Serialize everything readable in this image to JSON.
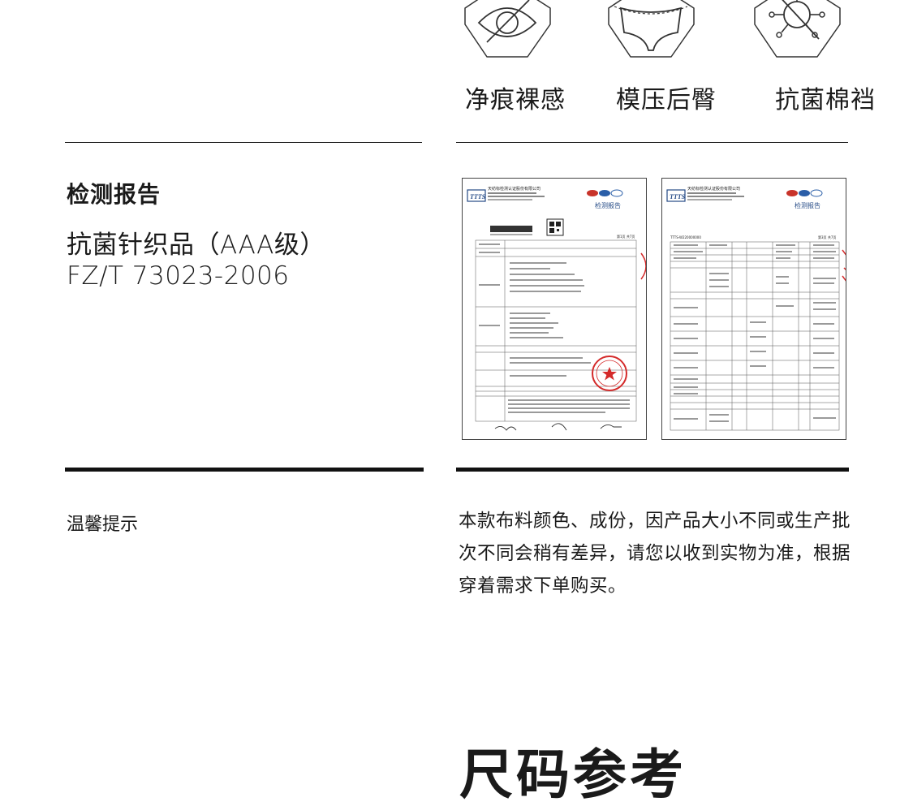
{
  "features": [
    {
      "label": "净痕裸感",
      "icon": "eye-slash-icon"
    },
    {
      "label": "模压后臀",
      "icon": "molded-brief-icon"
    },
    {
      "label": "抗菌棉裆",
      "icon": "antibacterial-virus-icon"
    }
  ],
  "report_section": {
    "title": "检测报告",
    "product_lines": [
      "抗菌针织品（AAA级）",
      "FZ/T 73023-2006"
    ],
    "reports": [
      {
        "org": "天纺标检测认证股份有限公司",
        "doc_title": "检测报告",
        "page": "第1页 共7页"
      },
      {
        "org": "天纺标检测认证股份有限公司",
        "doc_title": "检测报告",
        "page": "第3页 共7页",
        "report_no": "TTTS-W220000000"
      }
    ]
  },
  "tips": {
    "title": "温馨提示",
    "body": "本款布料颜色、成份，因产品大小不同或生产批次不同会稍有差异，请您以收到实物为准，根据穿着需求下单购买。"
  },
  "bottom_heading": "尺码参考",
  "colors": {
    "text": "#1a1a1a",
    "stamp": "#d42a2a",
    "rule": "#111111"
  }
}
